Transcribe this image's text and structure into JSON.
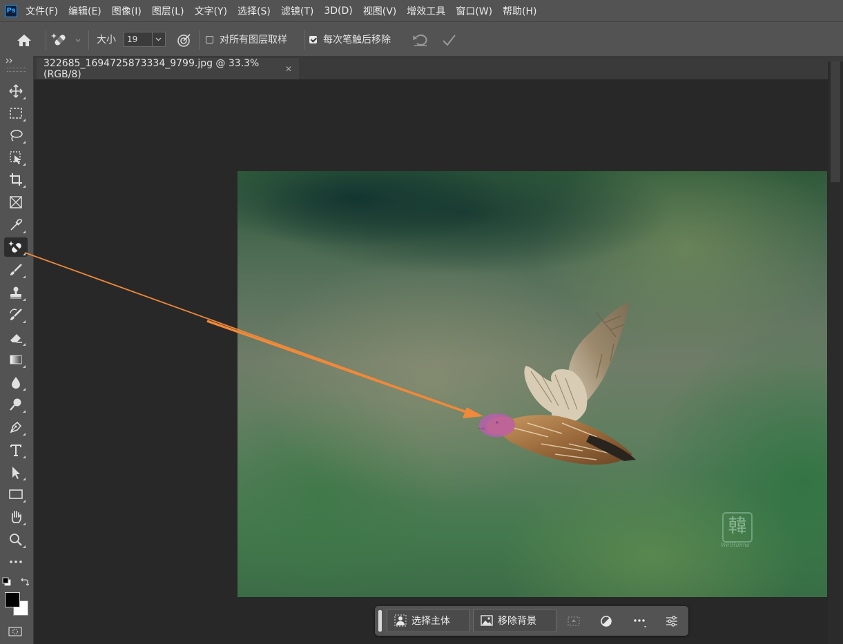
{
  "app": {
    "logo": "Ps"
  },
  "menu": [
    "文件(F)",
    "编辑(E)",
    "图像(I)",
    "图层(L)",
    "文字(Y)",
    "选择(S)",
    "滤镜(T)",
    "3D(D)",
    "视图(V)",
    "增效工具",
    "窗口(W)",
    "帮助(H)"
  ],
  "options": {
    "size_label": "大小",
    "size_value": "19",
    "sample_all_layers": {
      "label": "对所有图层取样",
      "checked": false
    },
    "remove_after_stroke": {
      "label": "每次笔触后移除",
      "checked": true
    }
  },
  "document": {
    "tab_title": "322685_1694725873334_9799.jpg @ 33.3%(RGB/8)"
  },
  "watermark": {
    "seal_char": "韓",
    "signature": "WeiHanna"
  },
  "contextual_taskbar": {
    "select_subject": "选择主体",
    "remove_background": "移除背景"
  },
  "tools": [
    "move-icon",
    "marquee-icon",
    "lasso-icon",
    "object-select-icon",
    "crop-icon",
    "frame-icon",
    "eyedropper-icon",
    "remove-tool-icon",
    "brush-icon",
    "stamp-icon",
    "history-brush-icon",
    "eraser-icon",
    "gradient-icon",
    "blur-icon",
    "dodge-icon",
    "pen-icon",
    "type-icon",
    "path-select-icon",
    "rectangle-icon",
    "hand-icon",
    "zoom-icon",
    "more-tools-icon"
  ],
  "colors": {
    "foreground": "#000000",
    "background": "#ffffff",
    "annotation_arrow": "#f0893a",
    "brush_stroke": "#c05ab8"
  }
}
